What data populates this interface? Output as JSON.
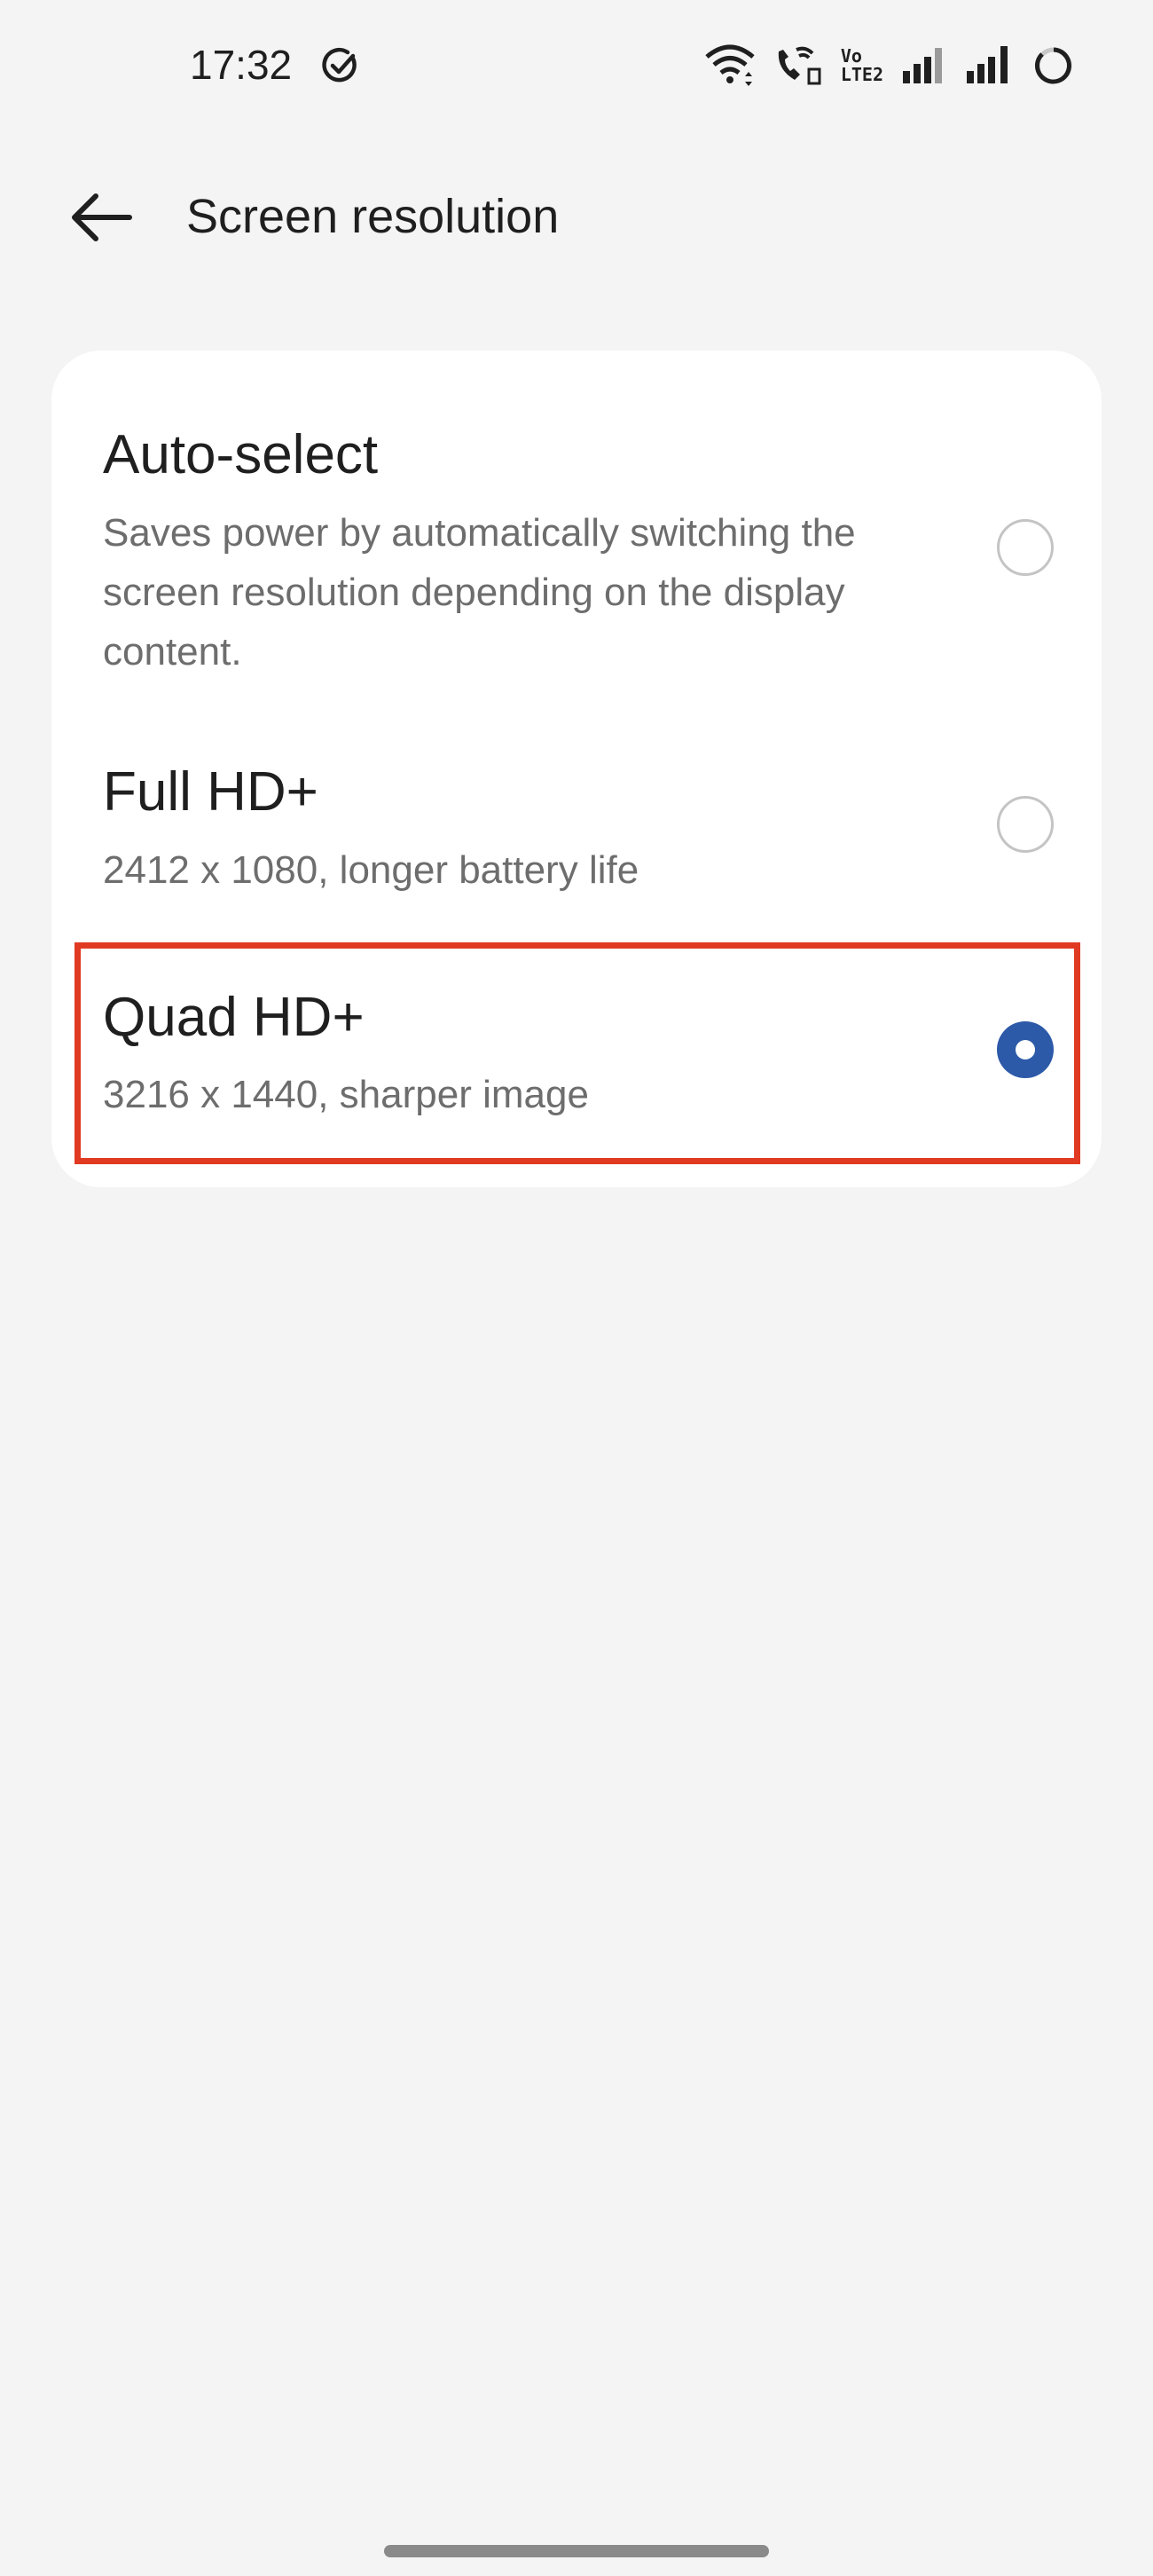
{
  "status_bar": {
    "time": "17:32",
    "icons": [
      "check-circle-icon",
      "wifi-icon",
      "wifi-calling-icon",
      "volte-icon",
      "signal-icon",
      "signal-icon",
      "battery-icon"
    ],
    "volte_label_top": "Vo",
    "volte_label_bottom": "LTE2"
  },
  "header": {
    "title": "Screen resolution",
    "back_icon": "arrow-left-icon"
  },
  "options": [
    {
      "title": "Auto-select",
      "description": "Saves power by automatically switching the screen resolution depending on the display content.",
      "selected": false
    },
    {
      "title": "Full HD+",
      "description": "2412 x 1080, longer battery life",
      "selected": false
    },
    {
      "title": "Quad HD+",
      "description": "3216 x 1440, sharper image",
      "selected": true
    }
  ],
  "colors": {
    "accent": "#2c59a8",
    "highlight": "#e03a22",
    "background": "#f4f4f4",
    "card": "#ffffff"
  }
}
